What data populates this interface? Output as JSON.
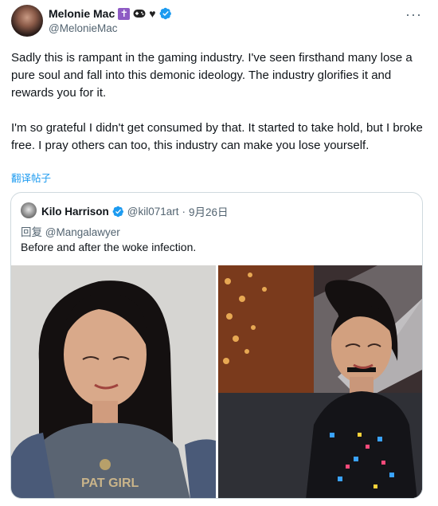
{
  "author": {
    "display_name": "Melonie Mac",
    "emoji": [
      "cross-emoji",
      "gamepad-emoji",
      "black-heart-emoji"
    ],
    "verified": true,
    "handle": "@MelonieMac"
  },
  "more_label": "···",
  "body": {
    "paragraph1": "Sadly this is rampant in the gaming industry. I've seen firsthand many lose a pure soul and fall into this demonic ideology. The industry glorifies it and rewards you for it.",
    "paragraph2": "I'm so grateful I didn't get consumed by that. It started to take hold, but I broke free. I pray others can too, this industry can make you lose yourself."
  },
  "translate_label": "翻译帖子",
  "quote": {
    "display_name": "Kilo Harrison",
    "verified": true,
    "handle": "@kil071art",
    "separator": "·",
    "date": "9月26日",
    "reply_prefix": "回复",
    "reply_to": "@Mangalawyer",
    "text": "Before and after the woke infection."
  },
  "colors": {
    "accent": "#1d9bf0",
    "muted": "#536471",
    "border": "#cfd9de"
  },
  "icons": {
    "verified": "verified-badge-icon",
    "more": "more-horizontal-icon"
  }
}
